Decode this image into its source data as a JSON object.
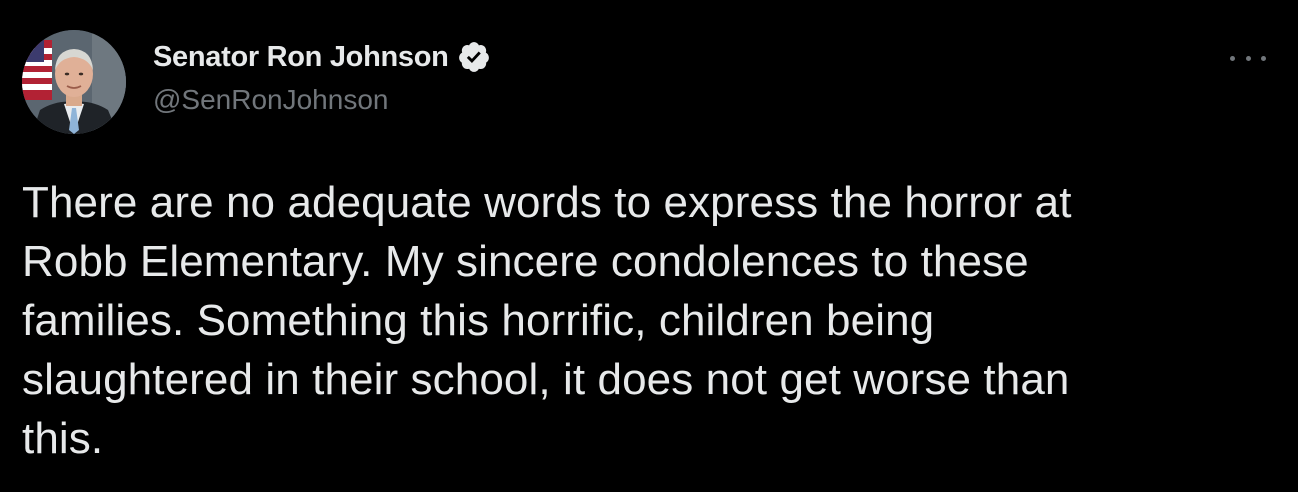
{
  "author": {
    "display_name": "Senator Ron Johnson",
    "handle": "@SenRonJohnson",
    "verified": true,
    "avatar_icon": "senator-portrait"
  },
  "menu_icon": "more-options-icon",
  "tweet": {
    "lines": [
      "There are no adequate words to express the horror at",
      "Robb Elementary. My sincere condolences to these",
      "families. Something this horrific, children being",
      "slaughtered in their school, it does not get worse than",
      "this."
    ]
  },
  "colors": {
    "background": "#000000",
    "text": "#e7e9ea",
    "secondary": "#71767b",
    "verified_badge": "#e7e9ea"
  }
}
